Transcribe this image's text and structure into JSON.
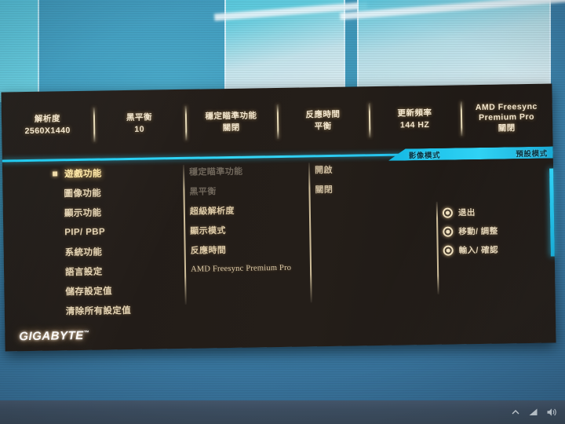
{
  "osd": {
    "brand": "GIGABYTE",
    "brand_mark": "™",
    "accent_color": "#2ed2f4",
    "text_color": "#e4d4b4",
    "highlight_color": "#ffe9a8",
    "status_bar": [
      {
        "label": "解析度",
        "value": "2560X1440"
      },
      {
        "label": "黑平衡",
        "value": "10"
      },
      {
        "label": "穩定瞄準功能",
        "value": "關閉"
      },
      {
        "label": "反應時間",
        "value": "平衡"
      },
      {
        "label": "更新頻率",
        "value": "144 HZ"
      },
      {
        "label": "AMD Freesync\nPremium Pro",
        "label_line1": "AMD Freesync",
        "label_line2": "Premium Pro",
        "value": "關閉"
      }
    ],
    "mode_banner": {
      "picture_mode_label": "影像模式",
      "picture_mode_value": "預設模式"
    },
    "main_menu": [
      {
        "label": "遊戲功能",
        "selected": true
      },
      {
        "label": "圖像功能",
        "selected": false
      },
      {
        "label": "顯示功能",
        "selected": false
      },
      {
        "label": "PIP/ PBP",
        "selected": false
      },
      {
        "label": "系統功能",
        "selected": false
      },
      {
        "label": "語言設定",
        "selected": false
      },
      {
        "label": "儲存設定值",
        "selected": false
      },
      {
        "label": "清除所有設定值",
        "selected": false
      }
    ],
    "sub_menu": [
      {
        "label": "穩定瞄準功能",
        "disabled": true,
        "latin": false
      },
      {
        "label": "黑平衡",
        "disabled": true,
        "latin": false
      },
      {
        "label": "超級解析度",
        "disabled": false,
        "latin": false
      },
      {
        "label": "顯示模式",
        "disabled": false,
        "latin": false
      },
      {
        "label": "反應時間",
        "disabled": false,
        "latin": false
      },
      {
        "label": "AMD Freesync Premium Pro",
        "disabled": false,
        "latin": true
      }
    ],
    "options": [
      {
        "label": "開啟"
      },
      {
        "label": "關閉"
      }
    ],
    "hints": [
      {
        "icon": "joystick-icon",
        "label": "退出"
      },
      {
        "icon": "joystick-icon",
        "label": "移動/ 調整"
      },
      {
        "icon": "joystick-icon",
        "label": "輸入/ 確認"
      }
    ]
  },
  "desktop": {
    "taskbar": {
      "tray_icons": [
        "chevron-up-icon",
        "network-icon",
        "volume-icon"
      ]
    }
  }
}
